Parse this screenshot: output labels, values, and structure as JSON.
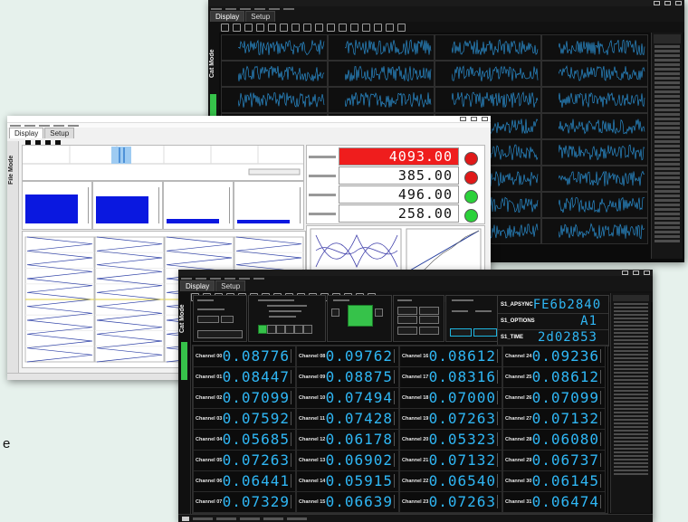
{
  "page": {
    "side_letter": "e"
  },
  "tabs": {
    "display": "Display",
    "setup": "Setup"
  },
  "sidebar": {
    "mode_label": "Cat Mode",
    "list_mode_label": "File Mode"
  },
  "colors": {
    "dark_bg": "#0b0b0b",
    "digit_blue": "#2fb7f5",
    "bar_blue": "#0a18e0",
    "readout_red": "#ef1d1d",
    "lamp_red": "#e01919",
    "lamp_green": "#2bd13a",
    "status_green": "#36c24a"
  },
  "icons": {
    "toolbar_dark": [
      "expand-icon",
      "pause-icon",
      "stop-icon",
      "chart-icon",
      "bar-chart-icon",
      "table-icon",
      "grid-icon",
      "cloud-icon",
      "target-icon",
      "network-icon",
      "text-icon",
      "formula-icon",
      "gauge-icon",
      "list-icon",
      "monitor-icon",
      "image-icon"
    ],
    "toolbar_light": [
      "back-icon",
      "play-icon",
      "forward-icon",
      "stop-icon"
    ]
  },
  "light_window": {
    "bar_panels": [
      {
        "fill": 0.9
      },
      {
        "fill": 0.82
      },
      {
        "fill": 0.14
      },
      {
        "fill": 0.1
      }
    ],
    "readouts": [
      {
        "value": "4093.00",
        "highlight": true,
        "lamp": "red"
      },
      {
        "value": "385.00",
        "highlight": false,
        "lamp": "red"
      },
      {
        "value": "496.00",
        "highlight": false,
        "lamp": "green"
      },
      {
        "value": "258.00",
        "highlight": false,
        "lamp": "green"
      }
    ]
  },
  "dark_window": {
    "id_fields": [
      {
        "name": "S1_APSYNC",
        "value": "FE6b2840"
      },
      {
        "name": "S1_OPTIONS",
        "value": "A1"
      },
      {
        "name": "S1_TIME",
        "value": "2d02853"
      }
    ],
    "channels": [
      {
        "name": "Channel 00",
        "value": "0.08776"
      },
      {
        "name": "Channel 08",
        "value": "0.09762"
      },
      {
        "name": "Channel 16",
        "value": "0.08612"
      },
      {
        "name": "Channel 24",
        "value": "0.09236"
      },
      {
        "name": "Channel 01",
        "value": "0.08447"
      },
      {
        "name": "Channel 09",
        "value": "0.08875"
      },
      {
        "name": "Channel 17",
        "value": "0.08316"
      },
      {
        "name": "Channel 25",
        "value": "0.08612"
      },
      {
        "name": "Channel 02",
        "value": "0.07099"
      },
      {
        "name": "Channel 10",
        "value": "0.07494"
      },
      {
        "name": "Channel 18",
        "value": "0.07000"
      },
      {
        "name": "Channel 26",
        "value": "0.07099"
      },
      {
        "name": "Channel 03",
        "value": "0.07592"
      },
      {
        "name": "Channel 11",
        "value": "0.07428"
      },
      {
        "name": "Channel 19",
        "value": "0.07263"
      },
      {
        "name": "Channel 27",
        "value": "0.07132"
      },
      {
        "name": "Channel 04",
        "value": "0.05685"
      },
      {
        "name": "Channel 12",
        "value": "0.06178"
      },
      {
        "name": "Channel 20",
        "value": "0.05323"
      },
      {
        "name": "Channel 28",
        "value": "0.06080"
      },
      {
        "name": "Channel 05",
        "value": "0.07263"
      },
      {
        "name": "Channel 13",
        "value": "0.06902"
      },
      {
        "name": "Channel 21",
        "value": "0.07132"
      },
      {
        "name": "Channel 29",
        "value": "0.06737"
      },
      {
        "name": "Channel 06",
        "value": "0.06441"
      },
      {
        "name": "Channel 14",
        "value": "0.05915"
      },
      {
        "name": "Channel 22",
        "value": "0.06540"
      },
      {
        "name": "Channel 30",
        "value": "0.06145"
      },
      {
        "name": "Channel 07",
        "value": "0.07329"
      },
      {
        "name": "Channel 15",
        "value": "0.06639"
      },
      {
        "name": "Channel 23",
        "value": "0.07263"
      },
      {
        "name": "Channel 31",
        "value": "0.06474"
      }
    ]
  }
}
